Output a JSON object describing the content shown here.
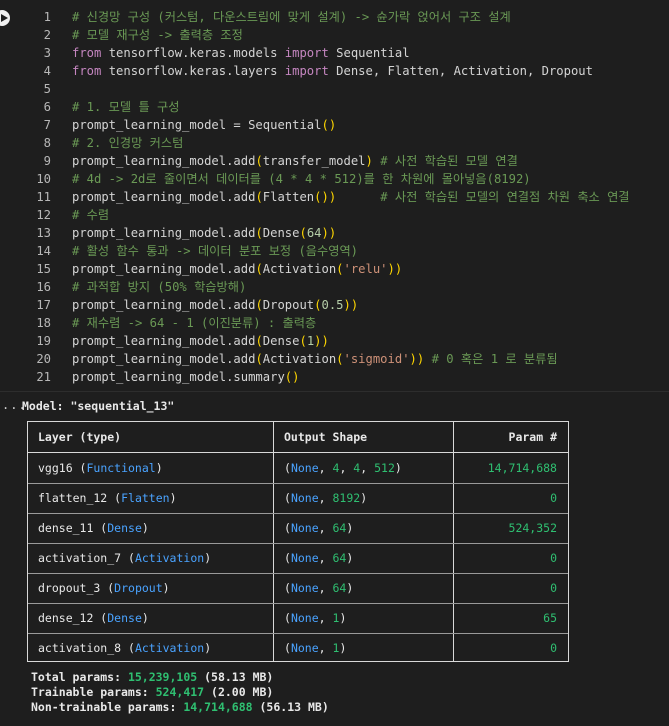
{
  "code": {
    "lines": [
      {
        "n": "1",
        "parts": [
          {
            "t": "# 신경망 구성 (커스텀, 다운스트림에 맞게 설계) -> 슌가락 얹어서 구조 설계",
            "c": "comment"
          }
        ]
      },
      {
        "n": "2",
        "parts": [
          {
            "t": "# 모델 재구성 -> 출력층 조정",
            "c": "comment"
          }
        ]
      },
      {
        "n": "3",
        "parts": [
          {
            "t": "from",
            "c": "kw"
          },
          {
            "t": " tensorflow.keras.models ",
            "c": ""
          },
          {
            "t": "import",
            "c": "kw"
          },
          {
            "t": " Sequential",
            "c": ""
          }
        ]
      },
      {
        "n": "4",
        "parts": [
          {
            "t": "from",
            "c": "kw"
          },
          {
            "t": " tensorflow.keras.layers ",
            "c": ""
          },
          {
            "t": "import",
            "c": "kw"
          },
          {
            "t": " Dense, Flatten, Activation, Dropout",
            "c": ""
          }
        ]
      },
      {
        "n": "5",
        "parts": []
      },
      {
        "n": "6",
        "parts": [
          {
            "t": "# 1. 모델 틀 구성",
            "c": "comment"
          }
        ]
      },
      {
        "n": "7",
        "parts": [
          {
            "t": "prompt_learning_model = Sequential",
            "c": ""
          },
          {
            "t": "()",
            "c": "paren"
          }
        ]
      },
      {
        "n": "8",
        "parts": [
          {
            "t": "# 2. 인경망 커스텀",
            "c": "comment"
          }
        ]
      },
      {
        "n": "9",
        "parts": [
          {
            "t": "prompt_learning_model.add",
            "c": ""
          },
          {
            "t": "(",
            "c": "paren"
          },
          {
            "t": "transfer_model",
            "c": ""
          },
          {
            "t": ")",
            "c": "paren"
          },
          {
            "t": " ",
            "c": ""
          },
          {
            "t": "# 사전 학습된 모델 연결",
            "c": "comment"
          }
        ]
      },
      {
        "n": "10",
        "parts": [
          {
            "t": "# 4d -> 2d로 줄이면서 데이터를 (4 * 4 * 512)를 한 차원에 몰아넣음(8192)",
            "c": "comment"
          }
        ]
      },
      {
        "n": "11",
        "parts": [
          {
            "t": "prompt_learning_model.add",
            "c": ""
          },
          {
            "t": "(",
            "c": "paren"
          },
          {
            "t": "Flatten",
            "c": ""
          },
          {
            "t": "())",
            "c": "paren"
          },
          {
            "t": "      ",
            "c": ""
          },
          {
            "t": "# 사전 학습된 모델의 연결점 차원 축소 연결",
            "c": "comment"
          }
        ]
      },
      {
        "n": "12",
        "parts": [
          {
            "t": "# 수렴",
            "c": "comment"
          }
        ]
      },
      {
        "n": "13",
        "parts": [
          {
            "t": "prompt_learning_model.add",
            "c": ""
          },
          {
            "t": "(",
            "c": "paren"
          },
          {
            "t": "Dense",
            "c": ""
          },
          {
            "t": "(",
            "c": "paren"
          },
          {
            "t": "64",
            "c": "num"
          },
          {
            "t": "))",
            "c": "paren"
          }
        ]
      },
      {
        "n": "14",
        "parts": [
          {
            "t": "# 활성 함수 통과 -> 데이터 분포 보정 (음수영역)",
            "c": "comment"
          }
        ]
      },
      {
        "n": "15",
        "parts": [
          {
            "t": "prompt_learning_model.add",
            "c": ""
          },
          {
            "t": "(",
            "c": "paren"
          },
          {
            "t": "Activation",
            "c": ""
          },
          {
            "t": "(",
            "c": "paren"
          },
          {
            "t": "'relu'",
            "c": "str"
          },
          {
            "t": "))",
            "c": "paren"
          }
        ]
      },
      {
        "n": "16",
        "parts": [
          {
            "t": "# 과적합 방지 (50% 학습방해)",
            "c": "comment"
          }
        ]
      },
      {
        "n": "17",
        "parts": [
          {
            "t": "prompt_learning_model.add",
            "c": ""
          },
          {
            "t": "(",
            "c": "paren"
          },
          {
            "t": "Dropout",
            "c": ""
          },
          {
            "t": "(",
            "c": "paren"
          },
          {
            "t": "0.5",
            "c": "num"
          },
          {
            "t": "))",
            "c": "paren"
          }
        ]
      },
      {
        "n": "18",
        "parts": [
          {
            "t": "# 재수렴 -> 64 - 1 (이진분류) : 출력층",
            "c": "comment"
          }
        ]
      },
      {
        "n": "19",
        "parts": [
          {
            "t": "prompt_learning_model.add",
            "c": ""
          },
          {
            "t": "(",
            "c": "paren"
          },
          {
            "t": "Dense",
            "c": ""
          },
          {
            "t": "(",
            "c": "paren"
          },
          {
            "t": "1",
            "c": "num"
          },
          {
            "t": "))",
            "c": "paren"
          }
        ]
      },
      {
        "n": "20",
        "parts": [
          {
            "t": "prompt_learning_model.add",
            "c": ""
          },
          {
            "t": "(",
            "c": "paren"
          },
          {
            "t": "Activation",
            "c": ""
          },
          {
            "t": "(",
            "c": "paren"
          },
          {
            "t": "'sigmoid'",
            "c": "str"
          },
          {
            "t": "))",
            "c": "paren"
          },
          {
            "t": " ",
            "c": ""
          },
          {
            "t": "# 0 혹은 1 로 분류됨",
            "c": "comment"
          }
        ]
      },
      {
        "n": "21",
        "parts": [
          {
            "t": "prompt_learning_model.summary",
            "c": ""
          },
          {
            "t": "()",
            "c": "paren"
          }
        ]
      }
    ]
  },
  "output": {
    "ellipsis": "...",
    "model_title": "Model: \"sequential_13\"",
    "headers": {
      "layer": "Layer (type)",
      "shape": "Output Shape",
      "param": "Param #"
    },
    "rows": [
      {
        "name": "vgg16",
        "type": "Functional",
        "shape": [
          "4",
          "4",
          "512"
        ],
        "param": "14,714,688"
      },
      {
        "name": "flatten_12",
        "type": "Flatten",
        "shape": [
          "8192"
        ],
        "param": "0"
      },
      {
        "name": "dense_11",
        "type": "Dense",
        "shape": [
          "64"
        ],
        "param": "524,352"
      },
      {
        "name": "activation_7",
        "type": "Activation",
        "shape": [
          "64"
        ],
        "param": "0"
      },
      {
        "name": "dropout_3",
        "type": "Dropout",
        "shape": [
          "64"
        ],
        "param": "0"
      },
      {
        "name": "dense_12",
        "type": "Dense",
        "shape": [
          "1"
        ],
        "param": "65"
      },
      {
        "name": "activation_8",
        "type": "Activation",
        "shape": [
          "1"
        ],
        "param": "0"
      }
    ],
    "none_label": "None",
    "totals": [
      {
        "label": "Total params:",
        "value": "15,239,105",
        "unit": "(58.13 MB)"
      },
      {
        "label": "Trainable params:",
        "value": "524,417",
        "unit": "(2.00 MB)"
      },
      {
        "label": "Non-trainable params:",
        "value": "14,714,688",
        "unit": "(56.13 MB)"
      }
    ]
  }
}
